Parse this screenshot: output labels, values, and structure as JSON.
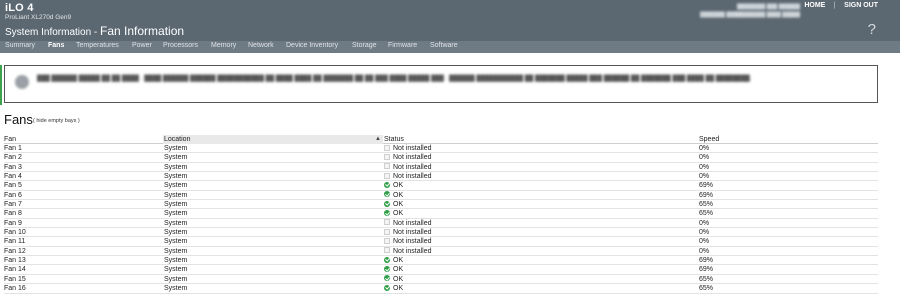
{
  "header": {
    "brand_title": "iLO 4",
    "brand_subtitle": "ProLiant XL270d Gen9",
    "home_label": "HOME",
    "separator": "|",
    "signout_label": "SIGN OUT",
    "page_title_prefix": "System Information - ",
    "page_title_main": "Fan Information",
    "help_glyph": "?"
  },
  "tabs": [
    {
      "label": "Summary",
      "active": false
    },
    {
      "label": "Fans",
      "active": true
    },
    {
      "label": "Temperatures",
      "active": false
    },
    {
      "label": "Power",
      "active": false
    },
    {
      "label": "Processors",
      "active": false
    },
    {
      "label": "Memory",
      "active": false
    },
    {
      "label": "Network",
      "active": false
    },
    {
      "label": "Device Inventory",
      "active": false
    },
    {
      "label": "Storage",
      "active": false
    },
    {
      "label": "Firmware",
      "active": false
    },
    {
      "label": "Software",
      "active": false
    }
  ],
  "section": {
    "title": "Fans",
    "hide_empty_label": "( hide empty bays )"
  },
  "table": {
    "headers": {
      "fan": "Fan",
      "location": "Location",
      "status": "Status",
      "speed": "Speed"
    },
    "sort_glyph": "▲",
    "rows": [
      {
        "fan": "Fan 1",
        "location": "System",
        "status": "Not installed",
        "ok": false,
        "speed": "0%"
      },
      {
        "fan": "Fan 2",
        "location": "System",
        "status": "Not installed",
        "ok": false,
        "speed": "0%"
      },
      {
        "fan": "Fan 3",
        "location": "System",
        "status": "Not installed",
        "ok": false,
        "speed": "0%"
      },
      {
        "fan": "Fan 4",
        "location": "System",
        "status": "Not installed",
        "ok": false,
        "speed": "0%"
      },
      {
        "fan": "Fan 5",
        "location": "System",
        "status": "OK",
        "ok": true,
        "speed": "69%"
      },
      {
        "fan": "Fan 6",
        "location": "System",
        "status": "OK",
        "ok": true,
        "speed": "69%"
      },
      {
        "fan": "Fan 7",
        "location": "System",
        "status": "OK",
        "ok": true,
        "speed": "65%"
      },
      {
        "fan": "Fan 8",
        "location": "System",
        "status": "OK",
        "ok": true,
        "speed": "65%"
      },
      {
        "fan": "Fan 9",
        "location": "System",
        "status": "Not installed",
        "ok": false,
        "speed": "0%"
      },
      {
        "fan": "Fan 10",
        "location": "System",
        "status": "Not installed",
        "ok": false,
        "speed": "0%"
      },
      {
        "fan": "Fan 11",
        "location": "System",
        "status": "Not installed",
        "ok": false,
        "speed": "0%"
      },
      {
        "fan": "Fan 12",
        "location": "System",
        "status": "Not installed",
        "ok": false,
        "speed": "0%"
      },
      {
        "fan": "Fan 13",
        "location": "System",
        "status": "OK",
        "ok": true,
        "speed": "69%"
      },
      {
        "fan": "Fan 14",
        "location": "System",
        "status": "OK",
        "ok": true,
        "speed": "69%"
      },
      {
        "fan": "Fan 15",
        "location": "System",
        "status": "OK",
        "ok": true,
        "speed": "65%"
      },
      {
        "fan": "Fan 16",
        "location": "System",
        "status": "OK",
        "ok": true,
        "speed": "65%"
      }
    ]
  },
  "colors": {
    "header_bg": "#5b6771",
    "tab_bar_bg": "#6e7a84",
    "status_ok": "#2f9e47",
    "banner_marker": "#3fa34d"
  }
}
